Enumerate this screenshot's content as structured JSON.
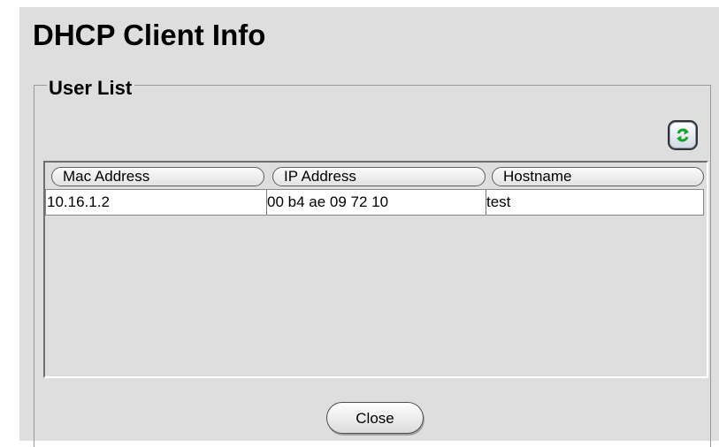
{
  "page": {
    "title": "DHCP Client Info"
  },
  "user_list": {
    "legend": "User List",
    "refresh_icon": "refresh-icon",
    "columns": [
      "Mac Address",
      "IP Address",
      "Hostname"
    ],
    "rows": [
      {
        "mac_address": "10.16.1.2",
        "ip_address": "00 b4 ae 09 72 10",
        "hostname": "test"
      }
    ]
  },
  "footer": {
    "close_label": "Close"
  },
  "colors": {
    "panel_background": "#dedede",
    "row_background": "#ffffff",
    "refresh_arrow": "#1aa12a"
  }
}
